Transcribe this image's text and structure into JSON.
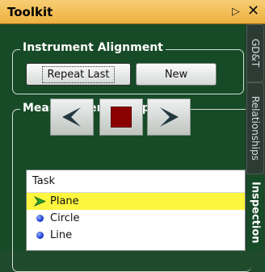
{
  "window": {
    "title": "Toolkit",
    "pin_glyph": "▷",
    "close_glyph": "✕"
  },
  "alignment": {
    "title": "Instrument Alignment",
    "repeat_last_label": "Repeat Last",
    "new_label": "New"
  },
  "trapping": {
    "title": "Measurement Trapping",
    "buttons": [
      "previous-icon",
      "stop-icon",
      "next-icon"
    ],
    "stop_color": "#8b0000"
  },
  "task_list": {
    "header": "Task",
    "items": [
      {
        "label": "Plane",
        "icon": "arrow-icon",
        "selected": true
      },
      {
        "label": "Circle",
        "icon": "blue-dot-icon",
        "selected": false
      },
      {
        "label": "Line",
        "icon": "blue-dot-icon",
        "selected": false
      }
    ]
  },
  "tabs": [
    "GD&T",
    "Relationships",
    "Inspection"
  ],
  "active_tab": "Inspection",
  "colors": {
    "title_bar": "#f0b84c",
    "panel_bg": "#174a27",
    "selected_row": "#fdf63f"
  }
}
